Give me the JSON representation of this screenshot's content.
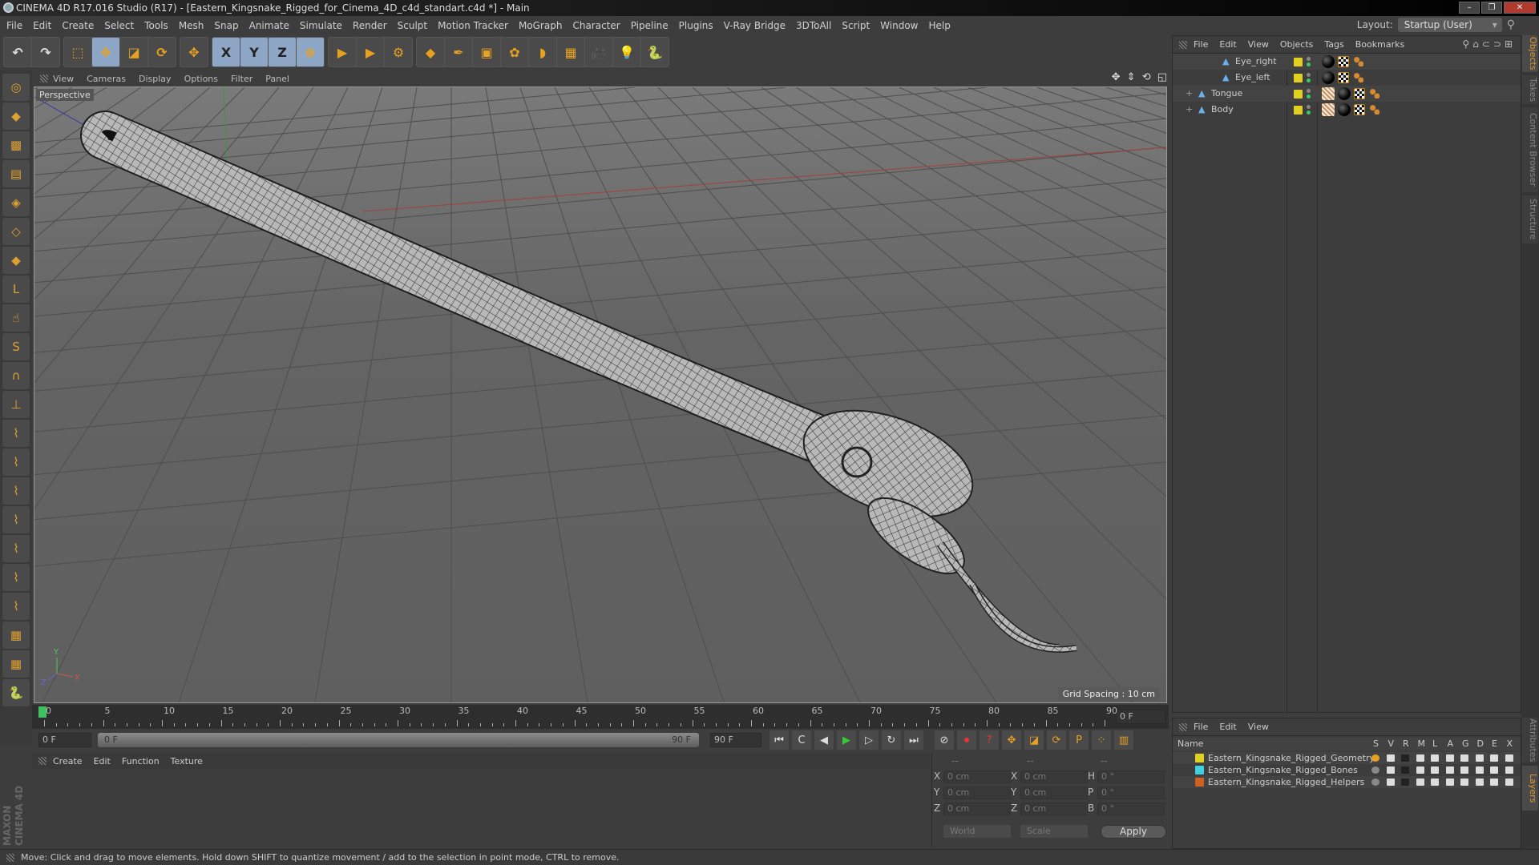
{
  "window": {
    "title": "CINEMA 4D R17.016 Studio (R17) - [Eastern_Kingsnake_Rigged_for_Cinema_4D_c4d_standart.c4d *] - Main",
    "controls": [
      "–",
      "❐",
      "✕"
    ]
  },
  "menu": [
    "File",
    "Edit",
    "Create",
    "Select",
    "Tools",
    "Mesh",
    "Snap",
    "Animate",
    "Simulate",
    "Render",
    "Sculpt",
    "Motion Tracker",
    "MoGraph",
    "Character",
    "Pipeline",
    "Plugins",
    "V-Ray Bridge",
    "3DToAll",
    "Script",
    "Window",
    "Help"
  ],
  "layout": {
    "label": "Layout:",
    "value": "Startup (User)"
  },
  "toolbar": [
    [
      {
        "icon": "undo-icon",
        "glyph": "↶"
      },
      {
        "icon": "redo-icon",
        "glyph": "↷"
      }
    ],
    [
      {
        "icon": "live-selection-icon",
        "glyph": "⬚"
      },
      {
        "icon": "move-icon",
        "glyph": "✥",
        "active": true
      },
      {
        "icon": "scale-icon",
        "glyph": "◪"
      },
      {
        "icon": "rotate-icon",
        "glyph": "⟳"
      }
    ],
    [
      {
        "icon": "recent-tools-icon",
        "glyph": "✥"
      }
    ],
    [
      {
        "icon": "x-axis-lock-icon",
        "glyph": "X",
        "active": true
      },
      {
        "icon": "y-axis-lock-icon",
        "glyph": "Y",
        "active": true
      },
      {
        "icon": "z-axis-lock-icon",
        "glyph": "Z",
        "active": true
      },
      {
        "icon": "world-coordinates-icon",
        "glyph": "⊕",
        "active": true
      }
    ],
    [
      {
        "icon": "render-view-icon",
        "glyph": "▶"
      },
      {
        "icon": "render-picture-viewer-icon",
        "glyph": "▶"
      },
      {
        "icon": "render-settings-icon",
        "glyph": "⚙"
      }
    ],
    [
      {
        "icon": "cube-icon",
        "glyph": "◆"
      },
      {
        "icon": "pen-spline-icon",
        "glyph": "✒"
      },
      {
        "icon": "subdivision-surface-icon",
        "glyph": "▣"
      },
      {
        "icon": "cloner-icon",
        "glyph": "✿"
      },
      {
        "icon": "deformer-icon",
        "glyph": "◗"
      },
      {
        "icon": "floor-icon",
        "glyph": "▦"
      },
      {
        "icon": "camera-icon",
        "glyph": "🎥"
      },
      {
        "icon": "light-icon",
        "glyph": "💡"
      },
      {
        "icon": "python-icon",
        "glyph": "🐍"
      }
    ]
  ],
  "left_tools": [
    {
      "icon": "make-editable-icon",
      "glyph": "◎"
    },
    {
      "icon": "model-mode-icon",
      "glyph": "◆"
    },
    {
      "icon": "texture-mode-icon",
      "glyph": "▩"
    },
    {
      "icon": "workplane-icon",
      "glyph": "▤"
    },
    {
      "icon": "points-mode-icon",
      "glyph": "◈"
    },
    {
      "icon": "edges-mode-icon",
      "glyph": "◇"
    },
    {
      "icon": "polygons-mode-icon",
      "glyph": "◆"
    },
    {
      "icon": "axis-icon",
      "glyph": "L"
    },
    {
      "icon": "tweak-icon",
      "glyph": "☝"
    },
    {
      "icon": "snap-icon",
      "glyph": "S"
    },
    {
      "icon": "magnet-icon",
      "glyph": "∩"
    },
    {
      "icon": "workplane-axis-icon",
      "glyph": "⊥"
    },
    {
      "icon": "sculpt-brush-1-icon",
      "glyph": "⌇"
    },
    {
      "icon": "sculpt-brush-2-icon",
      "glyph": "⌇"
    },
    {
      "icon": "sculpt-brush-3-icon",
      "glyph": "⌇"
    },
    {
      "icon": "sculpt-brush-4-icon",
      "glyph": "⌇"
    },
    {
      "icon": "sculpt-brush-5-icon",
      "glyph": "⌇"
    },
    {
      "icon": "sculpt-brush-6-icon",
      "glyph": "⌇"
    },
    {
      "icon": "sculpt-brush-7-icon",
      "glyph": "⌇"
    },
    {
      "icon": "grid-lock-icon",
      "glyph": "▦"
    },
    {
      "icon": "grid-snap-icon",
      "glyph": "▦"
    },
    {
      "icon": "python-script-icon",
      "glyph": "🐍"
    }
  ],
  "branding": "MAXON CINEMA 4D",
  "viewport": {
    "menu": [
      "View",
      "Cameras",
      "Display",
      "Options",
      "Filter",
      "Panel"
    ],
    "label": "Perspective",
    "grid_spacing": "Grid Spacing : 10 cm",
    "nav_icons": "✥ ⇕ ⟲ ◱",
    "axis": {
      "x": "X",
      "y": "Y",
      "z": "Z"
    }
  },
  "timeline": {
    "ticks": [
      "0",
      "5",
      "10",
      "15",
      "20",
      "25",
      "30",
      "35",
      "40",
      "45",
      "50",
      "55",
      "60",
      "65",
      "70",
      "75",
      "80",
      "85",
      "90"
    ],
    "current_frame": "0 F",
    "start": "0 F",
    "range_start": "0 F",
    "range_end": "90 F",
    "end": "90 F"
  },
  "transport": [
    {
      "icon": "go-to-start-icon",
      "glyph": "⏮"
    },
    {
      "icon": "previous-key-icon",
      "glyph": "C"
    },
    {
      "icon": "step-back-icon",
      "glyph": "◀"
    },
    {
      "icon": "play-icon",
      "glyph": "▶"
    },
    {
      "icon": "step-forward-icon",
      "glyph": "▷"
    },
    {
      "icon": "next-key-icon",
      "glyph": "↻"
    },
    {
      "icon": "go-to-end-icon",
      "glyph": "⏭"
    },
    {
      "icon": "record-keys-icon",
      "glyph": "⊘"
    },
    {
      "icon": "auto-keying-icon",
      "glyph": "⏺"
    },
    {
      "icon": "keyframe-selection-icon",
      "glyph": "?"
    },
    {
      "icon": "key-position-icon",
      "glyph": "✥"
    },
    {
      "icon": "key-scale-icon",
      "glyph": "◪"
    },
    {
      "icon": "key-rotation-icon",
      "glyph": "⟳"
    },
    {
      "icon": "key-param-icon",
      "glyph": "P"
    },
    {
      "icon": "key-pla-icon",
      "glyph": "⁘"
    },
    {
      "icon": "timeline-window-icon",
      "glyph": "▥"
    }
  ],
  "material": {
    "menu": [
      "Create",
      "Edit",
      "Function",
      "Texture"
    ]
  },
  "coords": {
    "headers": [
      "--",
      "--",
      "--"
    ],
    "rows": [
      {
        "l1": "X",
        "v1": "0 cm",
        "l2": "X",
        "v2": "0 cm",
        "l3": "H",
        "v3": "0 °"
      },
      {
        "l1": "Y",
        "v1": "0 cm",
        "l2": "Y",
        "v2": "0 cm",
        "l3": "P",
        "v3": "0 °"
      },
      {
        "l1": "Z",
        "v1": "0 cm",
        "l2": "Z",
        "v2": "0 cm",
        "l3": "B",
        "v3": "0 °"
      }
    ],
    "mode": "World",
    "transform": "Scale",
    "apply": "Apply"
  },
  "objects": {
    "menu": [
      "File",
      "Edit",
      "View",
      "Objects",
      "Tags",
      "Bookmarks"
    ],
    "items": [
      {
        "name": "Eye_right",
        "indent": 2
      },
      {
        "name": "Eye_left",
        "indent": 2
      },
      {
        "name": "Tongue",
        "indent": 1,
        "expandable": true
      },
      {
        "name": "Body",
        "indent": 1,
        "expandable": true
      }
    ],
    "layer_color": "#e0d020"
  },
  "layers": {
    "menu": [
      "File",
      "Edit",
      "View"
    ],
    "columns": [
      "Name",
      "S",
      "V",
      "R",
      "M",
      "L",
      "A",
      "G",
      "D",
      "E",
      "X"
    ],
    "items": [
      {
        "name": "Eastern_Kingsnake_Rigged_Geometry",
        "color": "#e0d020"
      },
      {
        "name": "Eastern_Kingsnake_Rigged_Bones",
        "color": "#40d0e0"
      },
      {
        "name": "Eastern_Kingsnake_Rigged_Helpers",
        "color": "#d06020"
      }
    ]
  },
  "right_tabs": [
    "Objects",
    "Takes",
    "Content Browser",
    "Structure"
  ],
  "right_tabs_lower": [
    "Attributes",
    "Layers"
  ],
  "status": "Move: Click and drag to move elements. Hold down SHIFT to quantize movement / add to the selection in point mode, CTRL to remove."
}
